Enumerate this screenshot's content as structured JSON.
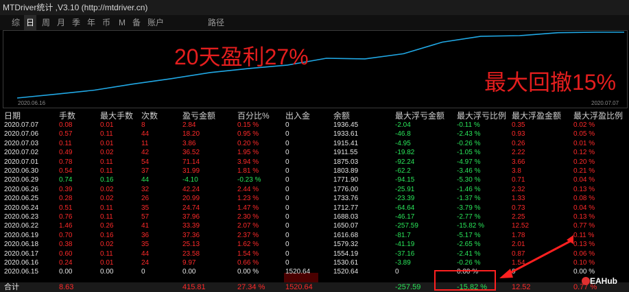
{
  "window": {
    "title": "MTDriver统计 ,V3.10 (http://mtdriver.cn)"
  },
  "tabs": [
    {
      "label": "综",
      "active": false
    },
    {
      "label": "日",
      "active": true
    },
    {
      "label": "周",
      "active": false
    },
    {
      "label": "月",
      "active": false
    },
    {
      "label": "季",
      "active": false
    },
    {
      "label": "年",
      "active": false
    },
    {
      "label": "币",
      "active": false
    },
    {
      "label": "M",
      "active": false
    },
    {
      "label": "备",
      "active": false
    },
    {
      "label": "账户",
      "active": false
    },
    {
      "label": "路径",
      "active": false
    }
  ],
  "chart": {
    "start_date": "2020.06.16",
    "end_date": "2020.07.07",
    "line_color": "#21a9e6",
    "equity": [
      1530.61,
      1554.19,
      1579.32,
      1616.68,
      1650.07,
      1688.03,
      1712.77,
      1733.76,
      1776.0,
      1771.9,
      1803.89,
      1875.03,
      1911.55,
      1915.41,
      1933.61,
      1936.45
    ]
  },
  "annotations": {
    "profit": "20天盈利27%",
    "drawdown": "最大回撤15%"
  },
  "table": {
    "headers": [
      "日期",
      "手数",
      "最大手数",
      "次数",
      "盈亏金额",
      "百分比%",
      "出入金",
      "余额",
      "最大浮亏金额",
      "最大浮亏比例",
      "最大浮盈金额",
      "最大浮盈比例"
    ],
    "rows": [
      [
        "2020.07.07",
        "0.08",
        "0.01",
        "8",
        "2.84",
        "0.15 %",
        "0",
        "1936.45",
        "-2.04",
        "-0.11 %",
        "0.35",
        "0.02 %"
      ],
      [
        "2020.07.06",
        "0.57",
        "0.11",
        "44",
        "18.20",
        "0.95 %",
        "0",
        "1933.61",
        "-46.8",
        "-2.43 %",
        "0.93",
        "0.05 %"
      ],
      [
        "2020.07.03",
        "0.11",
        "0.01",
        "11",
        "3.86",
        "0.20 %",
        "0",
        "1915.41",
        "-4.95",
        "-0.26 %",
        "0.26",
        "0.01 %"
      ],
      [
        "2020.07.02",
        "0.49",
        "0.02",
        "42",
        "36.52",
        "1.95 %",
        "0",
        "1911.55",
        "-19.82",
        "-1.05 %",
        "2.22",
        "0.12 %"
      ],
      [
        "2020.07.01",
        "0.78",
        "0.11",
        "54",
        "71.14",
        "3.94 %",
        "0",
        "1875.03",
        "-92.24",
        "-4.97 %",
        "3.66",
        "0.20 %"
      ],
      [
        "2020.06.30",
        "0.54",
        "0.11",
        "37",
        "31.99",
        "1.81 %",
        "0",
        "1803.89",
        "-62.2",
        "-3.46 %",
        "3.8",
        "0.21 %"
      ],
      [
        "2020.06.29",
        "0.74",
        "0.16",
        "44",
        "-4.10",
        "-0.23 %",
        "0",
        "1771.90",
        "-94.15",
        "-5.30 %",
        "0.71",
        "0.04 %"
      ],
      [
        "2020.06.26",
        "0.39",
        "0.02",
        "32",
        "42.24",
        "2.44 %",
        "0",
        "1776.00",
        "-25.91",
        "-1.46 %",
        "2.32",
        "0.13 %"
      ],
      [
        "2020.06.25",
        "0.28",
        "0.02",
        "26",
        "20.99",
        "1.23 %",
        "0",
        "1733.76",
        "-23.39",
        "-1.37 %",
        "1.33",
        "0.08 %"
      ],
      [
        "2020.06.24",
        "0.51",
        "0.11",
        "35",
        "24.74",
        "1.47 %",
        "0",
        "1712.77",
        "-64.64",
        "-3.79 %",
        "0.73",
        "0.04 %"
      ],
      [
        "2020.06.23",
        "0.76",
        "0.11",
        "57",
        "37.96",
        "2.30 %",
        "0",
        "1688.03",
        "-46.17",
        "-2.77 %",
        "2.25",
        "0.13 %"
      ],
      [
        "2020.06.22",
        "1.46",
        "0.26",
        "41",
        "33.39",
        "2.07 %",
        "0",
        "1650.07",
        "-257.59",
        "-15.82 %",
        "12.52",
        "0.77 %"
      ],
      [
        "2020.06.19",
        "0.70",
        "0.16",
        "36",
        "37.36",
        "2.37 %",
        "0",
        "1616.68",
        "-81.7",
        "-5.17 %",
        "1.78",
        "0.11 %"
      ],
      [
        "2020.06.18",
        "0.38",
        "0.02",
        "35",
        "25.13",
        "1.62 %",
        "0",
        "1579.32",
        "-41.19",
        "-2.65 %",
        "2.01",
        "0.13 %"
      ],
      [
        "2020.06.17",
        "0.60",
        "0.11",
        "44",
        "23.58",
        "1.54 %",
        "0",
        "1554.19",
        "-37.16",
        "-2.41 %",
        "0.87",
        "0.06 %"
      ],
      [
        "2020.06.16",
        "0.24",
        "0.01",
        "24",
        "9.97",
        "0.66 %",
        "0",
        "1530.61",
        "-3.89",
        "-0.26 %",
        "1.54",
        "0.10 %"
      ],
      [
        "2020.06.15",
        "0.00",
        "0.00",
        "0",
        "0.00",
        "0.00 %",
        "1520.64",
        "1520.64",
        "0",
        "0.00 %",
        "0",
        "0.00 %"
      ]
    ],
    "total": [
      "合计",
      "8.63",
      "",
      "",
      "415.81",
      "27.34 %",
      "1520.64",
      "",
      "-257.59",
      "-15.82 %",
      "12.52",
      "0.77 %"
    ]
  },
  "watermark": "EAHub"
}
